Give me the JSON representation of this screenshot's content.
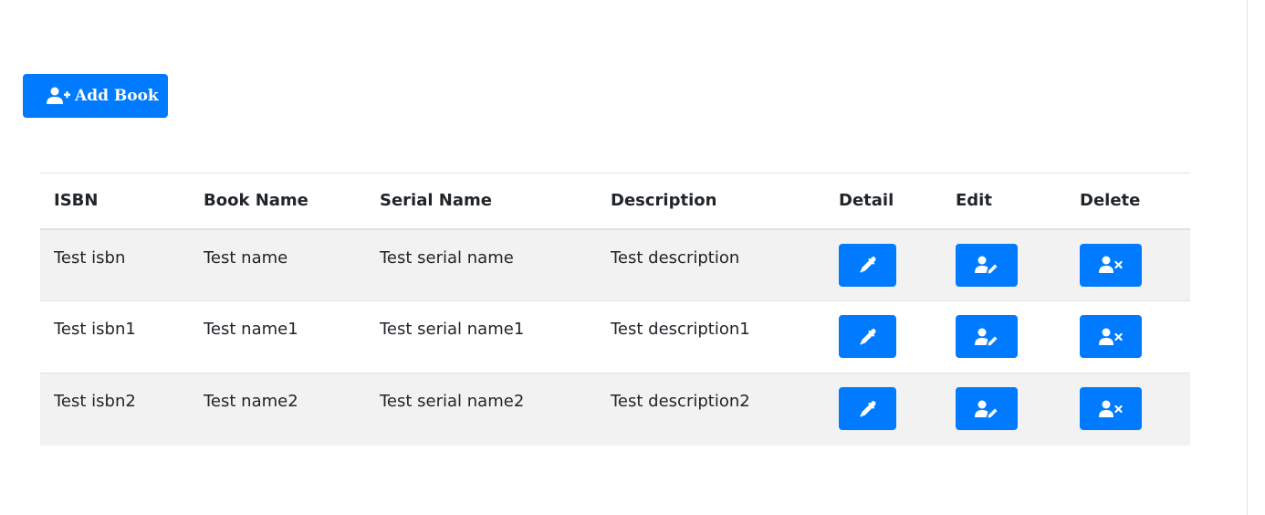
{
  "toolbar": {
    "add_label": "Add Book",
    "add_icon": "user-plus-icon"
  },
  "table": {
    "headers": {
      "isbn": "ISBN",
      "book_name": "Book Name",
      "serial_name": "Serial Name",
      "description": "Description",
      "detail": "Detail",
      "edit": "Edit",
      "delete": "Delete"
    },
    "rows": [
      {
        "isbn": "Test isbn",
        "book_name": "Test name",
        "serial_name": "Test serial name",
        "description": "Test description"
      },
      {
        "isbn": "Test isbn1",
        "book_name": "Test name1",
        "serial_name": "Test serial name1",
        "description": "Test description1"
      },
      {
        "isbn": "Test isbn2",
        "book_name": "Test name2",
        "serial_name": "Test serial name2",
        "description": "Test description2"
      }
    ],
    "action_icons": {
      "detail": "eyedropper-icon",
      "edit": "user-edit-icon",
      "delete": "user-times-icon"
    }
  },
  "colors": {
    "primary": "#007bff",
    "stripe": "#f2f2f2",
    "border": "#dee2e6"
  }
}
